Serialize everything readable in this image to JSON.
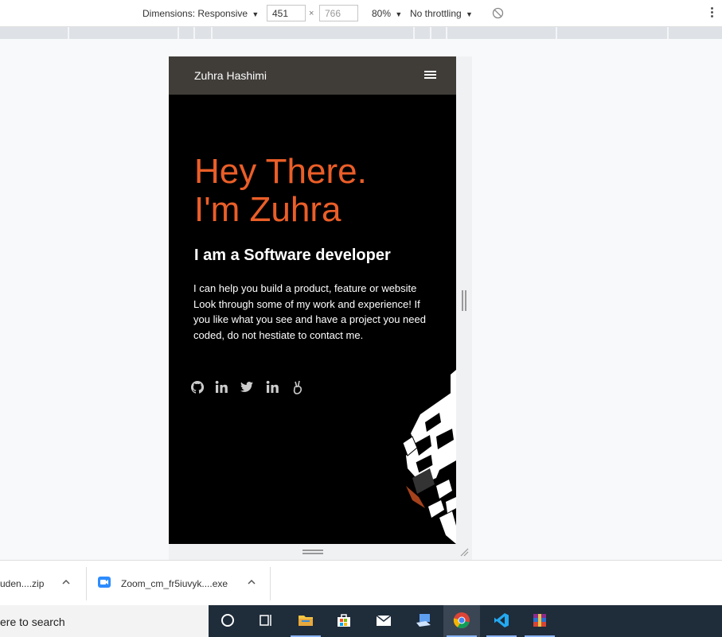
{
  "devtools": {
    "dimensions_label": "Dimensions: Responsive",
    "width_value": "451",
    "height_value": "766",
    "times": "×",
    "zoom_label": "80%",
    "throttling_label": "No throttling",
    "dropdown_arrow": "▼"
  },
  "site": {
    "brand": "Zuhra Hashimi",
    "hero_line1": "Hey There.",
    "hero_line2": "I'm Zuhra",
    "subtitle": "I am a Software developer",
    "intro": "I can help you build a product, feature or website Look through some of my work and experience! If you like what you see and have a project you need coded, do not hestiate to contact me.",
    "accent_color": "#eb5e28",
    "nav_color": "#403d39",
    "social_icons": [
      "github-icon",
      "linkedin-icon",
      "twitter-icon",
      "linkedin-icon",
      "angellist-icon"
    ]
  },
  "downloads": {
    "items": [
      {
        "name": "uden....zip"
      },
      {
        "name": "Zoom_cm_fr5iuvyk....exe"
      }
    ]
  },
  "taskbar": {
    "search_text": "ere to search",
    "apps": [
      "cortana-icon",
      "task-view-icon",
      "file-explorer-icon",
      "store-icon",
      "mail-icon",
      "remote-desktop-icon",
      "chrome-icon",
      "vscode-icon",
      "winrar-icon"
    ]
  }
}
